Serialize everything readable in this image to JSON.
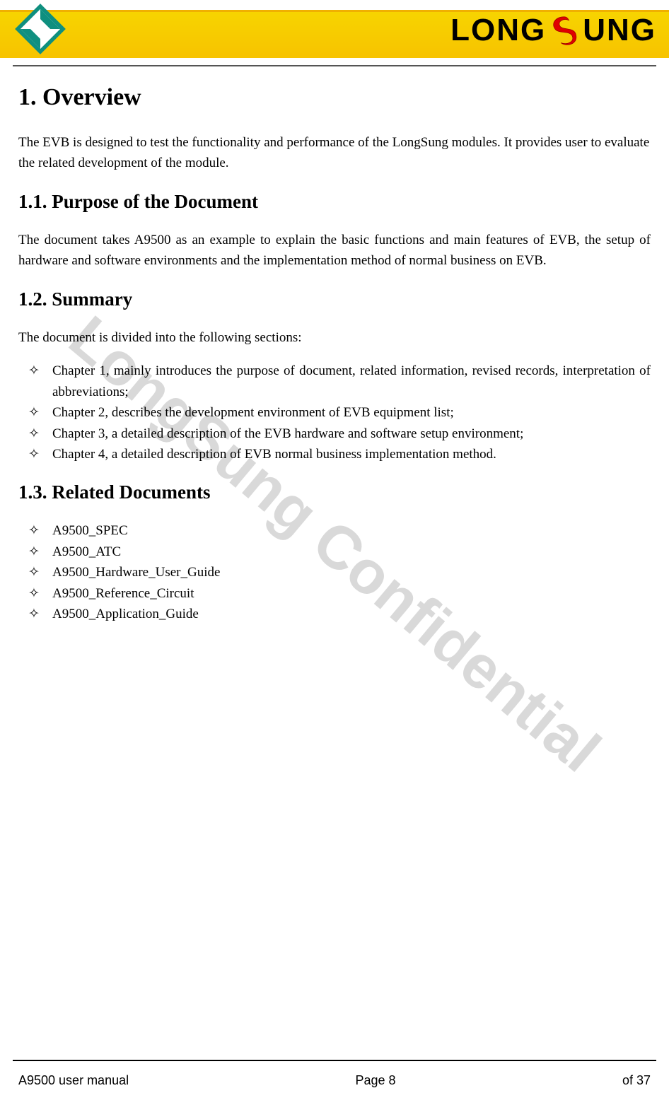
{
  "brand": {
    "wordmark_left": "LONG",
    "wordmark_right": "UNG"
  },
  "watermark": "LongSung Confidential",
  "sections": {
    "h1": "1. Overview",
    "overview_p": "The EVB is designed to test the functionality and performance of the LongSung modules. It provides user to evaluate the related development of the module.",
    "h2_purpose": "1.1. Purpose of the Document",
    "purpose_p": "The document takes A9500 as an example to explain the basic functions and main features of EVB, the setup of hardware and software environments and the implementation method of normal business on EVB.",
    "h2_summary": "1.2. Summary",
    "summary_intro": "The document is divided into the following sections:",
    "summary_items": [
      "Chapter 1, mainly introduces the purpose of document, related information, revised records, interpretation of abbreviations;",
      "Chapter 2, describes the development environment of EVB equipment list;",
      "Chapter 3, a detailed description of the EVB hardware and software setup environment;",
      "Chapter 4, a detailed description of EVB normal business implementation method."
    ],
    "h2_related": "1.3. Related Documents",
    "related_items": [
      "A9500_SPEC",
      "A9500_ATC",
      "A9500_Hardware_User_Guide",
      "A9500_Reference_Circuit",
      "A9500_Application_Guide"
    ]
  },
  "footer": {
    "left": "A9500 user manual",
    "center": "Page 8",
    "right": "of 37"
  }
}
